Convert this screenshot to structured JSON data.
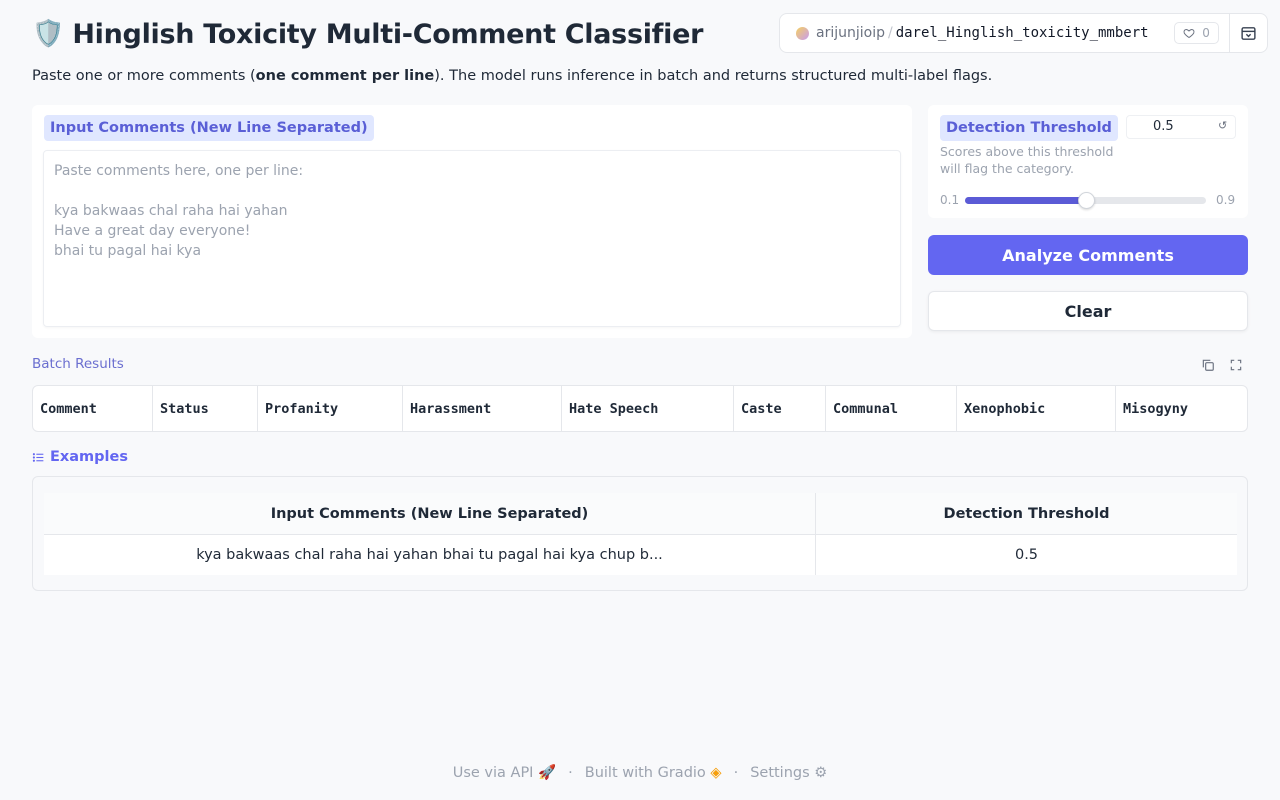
{
  "header": {
    "title_icon": "shield-icon",
    "title": "Hinglish Toxicity Multi-Comment Classifier",
    "space_owner": "arijunjioip",
    "space_repo": "darel_Hinglish_toxicity_mmbert",
    "like_count": "0"
  },
  "description": {
    "prefix": "Paste one or more comments (",
    "bold": "one comment per line",
    "suffix": "). The model runs inference in batch and returns structured multi-label flags."
  },
  "input": {
    "label": "Input Comments (New Line Separated)",
    "placeholder": "Paste comments here, one per line:\n\nkya bakwaas chal raha hai yahan\nHave a great day everyone!\nbhai tu pagal hai kya"
  },
  "threshold": {
    "label": "Detection Threshold",
    "value": "0.5",
    "info": "Scores above this threshold will flag the category.",
    "min_label": "0.1",
    "max_label": "0.9",
    "min": 0.1,
    "max": 0.9,
    "current": 0.5
  },
  "buttons": {
    "analyze": "Analyze Comments",
    "clear": "Clear"
  },
  "results": {
    "label": "Batch Results",
    "columns": [
      "Comment",
      "Status",
      "Profanity",
      "Harassment",
      "Hate Speech",
      "Caste",
      "Communal",
      "Xenophobic",
      "Misogyny"
    ]
  },
  "examples": {
    "label": "Examples",
    "headers": [
      "Input Comments (New Line Separated)",
      "Detection Threshold"
    ],
    "rows": [
      [
        "kya bakwaas chal raha hai yahan bhai tu pagal hai kya chup b...",
        "0.5"
      ]
    ]
  },
  "footer": {
    "api": "Use via API",
    "built": "Built with Gradio",
    "settings": "Settings"
  },
  "colors": {
    "accent": "#6366f1",
    "label_bg": "#e0e7ff"
  }
}
